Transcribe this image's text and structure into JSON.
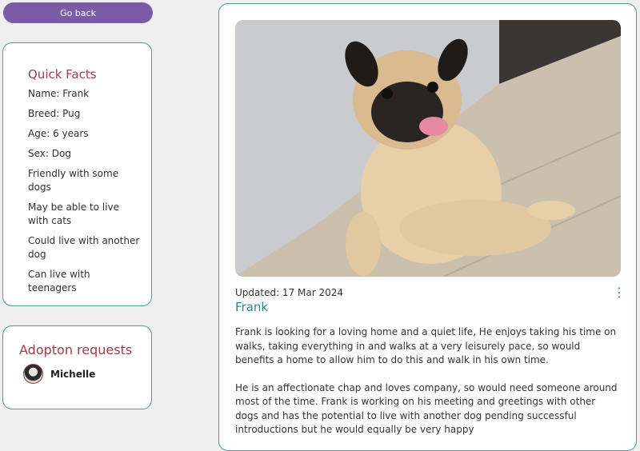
{
  "nav": {
    "back_label": "Go back"
  },
  "quick_facts": {
    "title": "Quick Facts",
    "items": [
      "Name: Frank",
      "Breed: Pug",
      "Age: 6 years",
      "Sex: Dog",
      "Friendly with some dogs",
      "May be able to live with cats",
      "Could live with another dog",
      "Can live with teenagers"
    ]
  },
  "adoption": {
    "title": "Adopton requests",
    "requests": [
      {
        "name": "Michelle"
      }
    ]
  },
  "pet": {
    "updated": "Updated: 17 Mar 2024",
    "name": "Frank",
    "description": [
      "Frank is looking for a loving home and a quiet life, He enjoys taking his time on walks, taking everything in and walks at a very leisurely pace, so would benefits a home to allow him to do this and walk in his own time.",
      "He is an affectionate chap and loves company, so would need someone around most of the time. Frank is working on his meeting and greetings with other dogs and has the potential to live with another dog pending successful introductions but he would equally be very happy"
    ]
  },
  "colors": {
    "accent": "#2a8a82",
    "heading": "#9a3f4b",
    "button": "#7b5aa6"
  }
}
